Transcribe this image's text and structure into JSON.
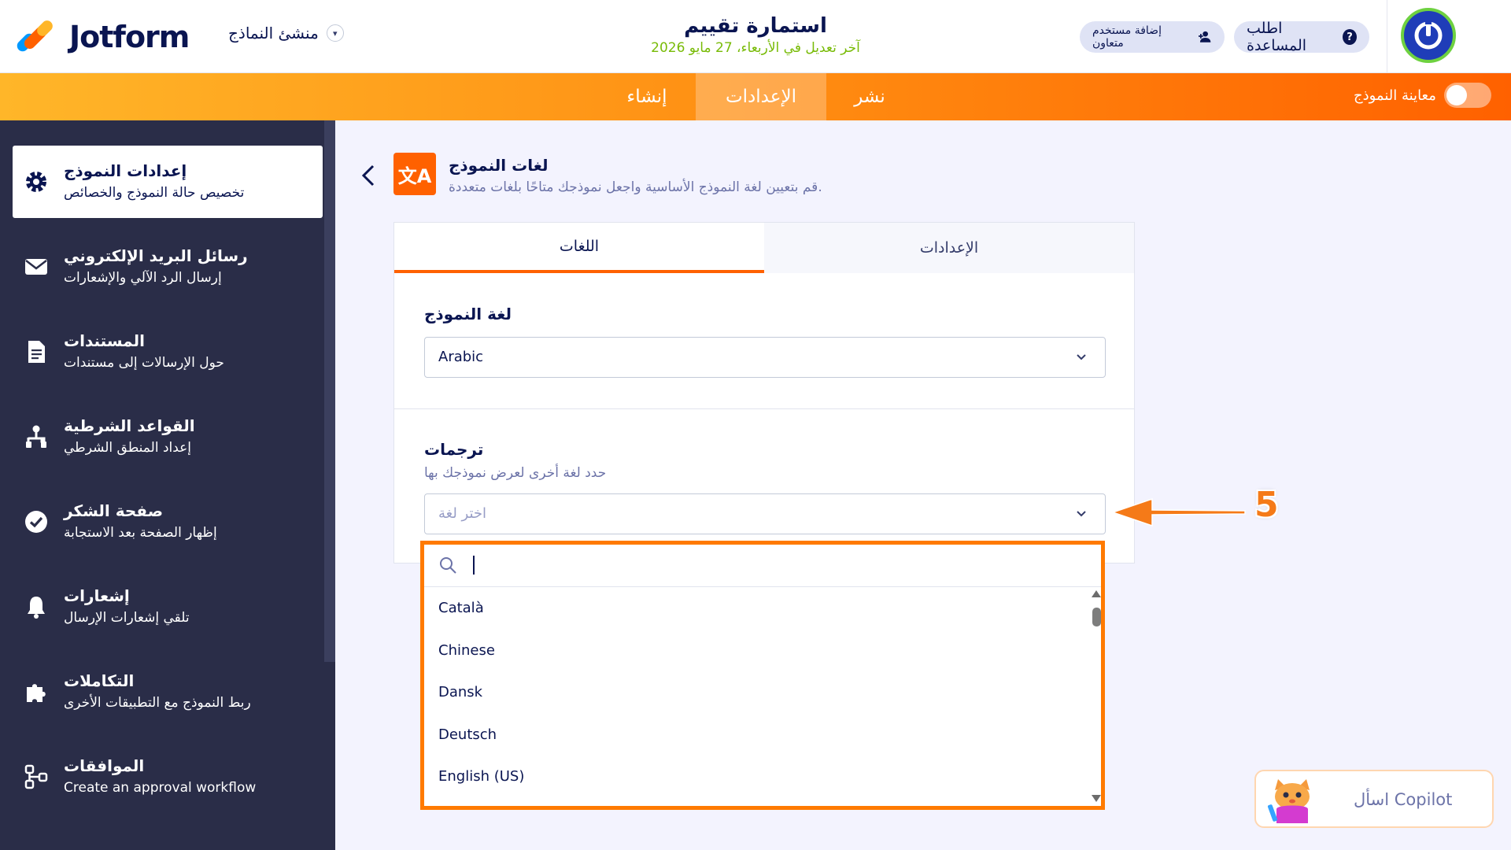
{
  "header": {
    "logo_text": "Jotform",
    "builder_label": "منشئ النماذج",
    "form_title": "استمارة تقييم",
    "last_edited": "آخر تعديل في الأربعاء، 27 مايو 2026",
    "help_button": "اطلب المساعدة",
    "collab_button": "إضافة مستخدم متعاون"
  },
  "nav": {
    "tabs": [
      "نشر",
      "الإعدادات",
      "إنشاء"
    ],
    "active_tab": "الإعدادات",
    "preview_label": "معاينة النموذج"
  },
  "sidebar": {
    "items": [
      {
        "title": "إعدادات النموذج",
        "desc": "تخصيص حالة النموذج والخصائص",
        "icon": "gear-icon"
      },
      {
        "title": "رسائل البريد الإلكتروني",
        "desc": "إرسال الرد الآلي والإشعارات",
        "icon": "envelope-icon"
      },
      {
        "title": "المستندات",
        "desc": "حول الإرسالات إلى مستندات",
        "icon": "document-icon"
      },
      {
        "title": "القواعد الشرطية",
        "desc": "إعداد المنطق الشرطي",
        "icon": "conditions-icon"
      },
      {
        "title": "صفحة الشكر",
        "desc": "إظهار الصفحة بعد الاستجابة",
        "icon": "check-circle-icon"
      },
      {
        "title": "إشعارات",
        "desc": "تلقي إشعارات الإرسال",
        "icon": "bell-icon"
      },
      {
        "title": "التكاملات",
        "desc": "ربط النموذج مع التطبيقات الأخرى",
        "icon": "puzzle-icon"
      },
      {
        "title": "الموافقات",
        "desc": "Create an approval workflow",
        "icon": "workflow-icon"
      }
    ]
  },
  "page": {
    "title": "لغات النموذج",
    "description": "قم بتعيين لغة النموذج الأساسية واجعل نموذجك متاحًا بلغات متعددة."
  },
  "card": {
    "tabs": {
      "settings": "الإعدادات",
      "languages": "اللغات"
    },
    "form_language_label": "لغة النموذج",
    "form_language_value": "Arabic",
    "translations_label": "ترجمات",
    "translations_help": "حدد لغة أخرى لعرض نموذجك بها",
    "translations_placeholder": "اختر لغة"
  },
  "dropdown": {
    "search_value": "",
    "options": [
      "Català",
      "Chinese",
      "Dansk",
      "Deutsch",
      "English (US)"
    ]
  },
  "annotation": {
    "step": "5"
  },
  "copilot": {
    "label": "اسأل Copilot"
  },
  "colors": {
    "accent": "#ff6100",
    "sidebar": "#2a2d48",
    "navy": "#0a1551",
    "highlight": "#ff7a00"
  }
}
